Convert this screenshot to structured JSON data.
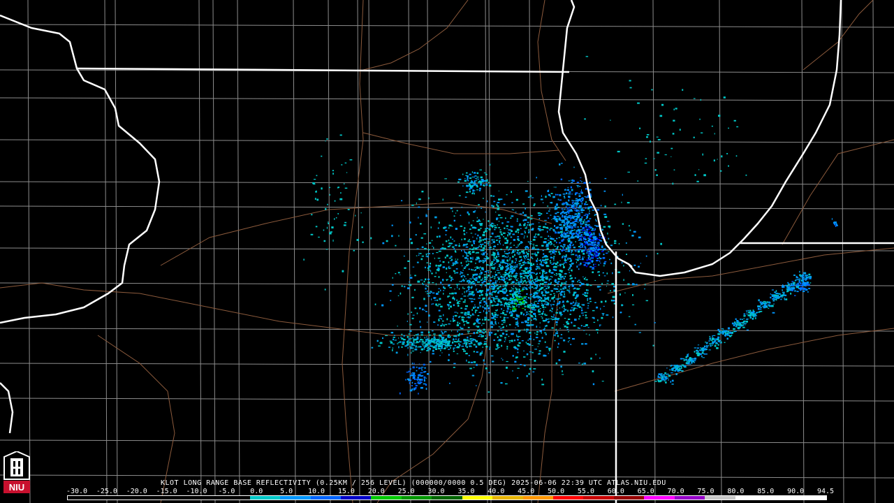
{
  "caption": "KLOT LONG RANGE BASE REFLECTIVITY (0.25KM / 256 LEVEL) (000000/0000 0.5 DEG) 2025-06-06 22:39 UTC  ATLAS.NIU.EDU",
  "logo_text": "NIU",
  "scale": {
    "labels": [
      "-30.0",
      "-25.0",
      "-20.0",
      "-15.0",
      "-10.0",
      "-5.0",
      "0.0",
      "5.0",
      "10.0",
      "15.0",
      "20.0",
      "25.0",
      "30.0",
      "35.0",
      "40.0",
      "45.0",
      "50.0",
      "55.0",
      "60.0",
      "65.0",
      "70.0",
      "75.0",
      "80.0",
      "85.0",
      "90.0",
      "94.5"
    ],
    "colors": [
      "#000000",
      "#000000",
      "#000000",
      "#000000",
      "#000000",
      "#000000",
      "#00c8c8",
      "#0096ff",
      "#0064ff",
      "#0000c8",
      "#00c800",
      "#009600",
      "#006400",
      "#ffff00",
      "#e6b400",
      "#ff9600",
      "#ff0000",
      "#c80000",
      "#960000",
      "#ff00ff",
      "#9600c8",
      "#c8c8c8",
      "#ffffff",
      "#ffffff",
      "#ffffff"
    ]
  },
  "map": {
    "boundary_colors": {
      "state": "#ffffff",
      "county": "#8c8c8c",
      "road": "#8b5a3c"
    },
    "echo_colors": [
      "#00c8c8",
      "#0096ff",
      "#0064ff",
      "#00a0e6",
      "#0000c8",
      "#00c800"
    ]
  }
}
